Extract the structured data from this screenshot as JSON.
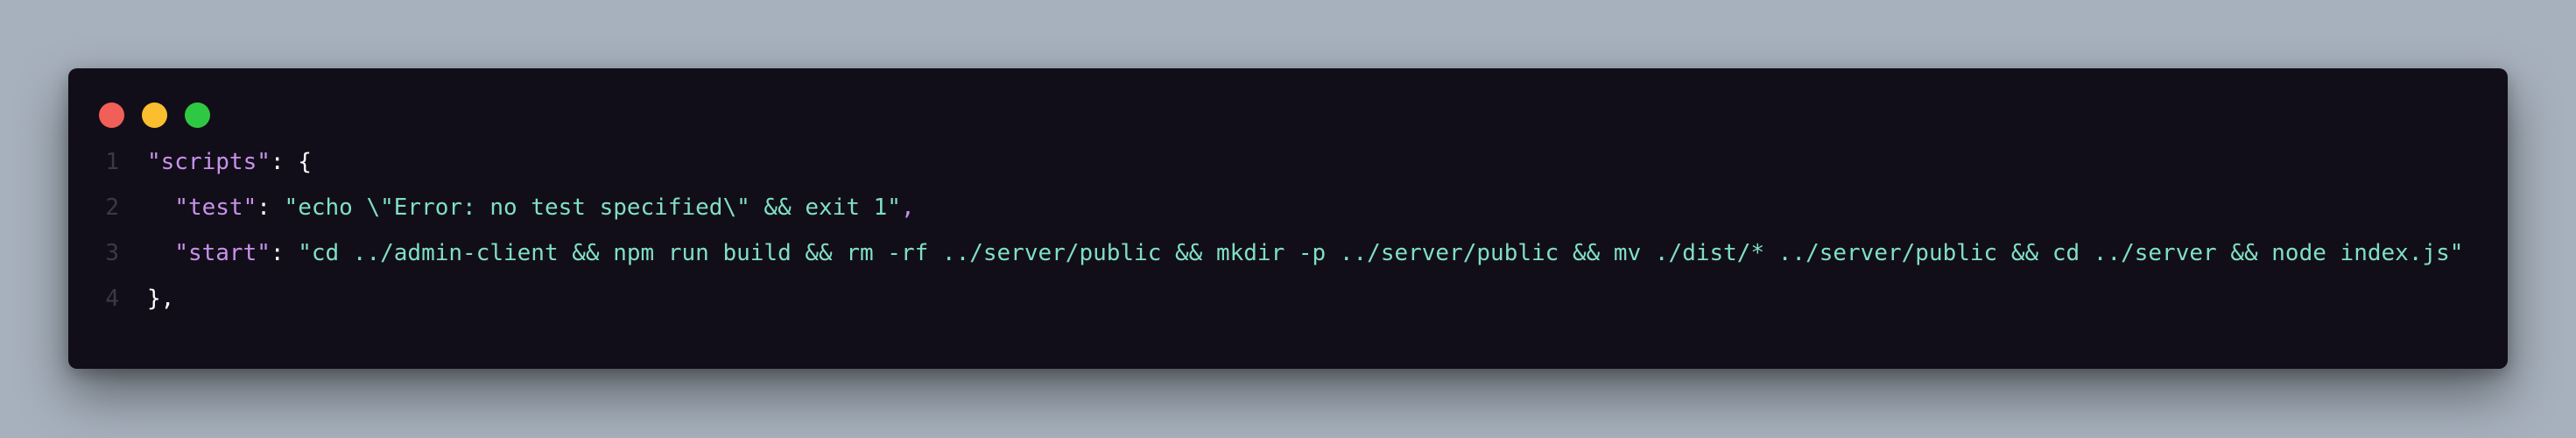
{
  "window": {
    "controls": [
      {
        "name": "close",
        "color": "#f25f58"
      },
      {
        "name": "minimize",
        "color": "#fbbe2e"
      },
      {
        "name": "zoom",
        "color": "#2fc842"
      }
    ]
  },
  "code": {
    "lines": [
      {
        "number": "1",
        "indent": "",
        "key": "\"scripts\"",
        "sep": ": ",
        "value": "",
        "tail": "{"
      },
      {
        "number": "2",
        "indent": "  ",
        "key": "\"test\"",
        "sep": ": ",
        "value": "\"echo \\\"Error: no test specified\\\" && exit 1\"",
        "tail": ","
      },
      {
        "number": "3",
        "indent": "  ",
        "key": "\"start\"",
        "sep": ": ",
        "value": "\"cd ../admin-client && npm run build && rm -rf ../server/public && mkdir -p ../server/public && mv ./dist/* ../server/public && cd ../server && node index.js\"",
        "tail": ""
      },
      {
        "number": "4",
        "indent": "",
        "key": "",
        "sep": "",
        "value": "",
        "tail": "},"
      }
    ]
  }
}
